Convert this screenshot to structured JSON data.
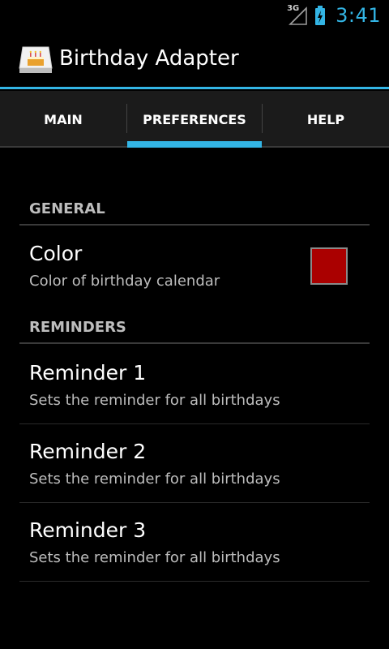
{
  "status_bar": {
    "network_label": "3G",
    "time": "3:41",
    "icons": [
      "signal-icon",
      "battery-charging-icon"
    ]
  },
  "action_bar": {
    "title": "Birthday Adapter",
    "icon": "birthday-cake-icon"
  },
  "tabs": [
    {
      "label": "MAIN",
      "selected": false
    },
    {
      "label": "PREFERENCES",
      "selected": true
    },
    {
      "label": "HELP",
      "selected": false
    }
  ],
  "preferences": {
    "general": {
      "header": "GENERAL",
      "color": {
        "title": "Color",
        "summary": "Color of birthday calendar",
        "value": "#aa0000"
      }
    },
    "reminders": {
      "header": "REMINDERS",
      "items": [
        {
          "title": "Reminder 1",
          "summary": "Sets the reminder for all birthdays"
        },
        {
          "title": "Reminder 2",
          "summary": "Sets the reminder for all birthdays"
        },
        {
          "title": "Reminder 3",
          "summary": "Sets the reminder for all birthdays"
        }
      ]
    }
  },
  "colors": {
    "accent": "#33b5e5",
    "background": "#000000",
    "secondary_text": "#bdbdbd"
  }
}
